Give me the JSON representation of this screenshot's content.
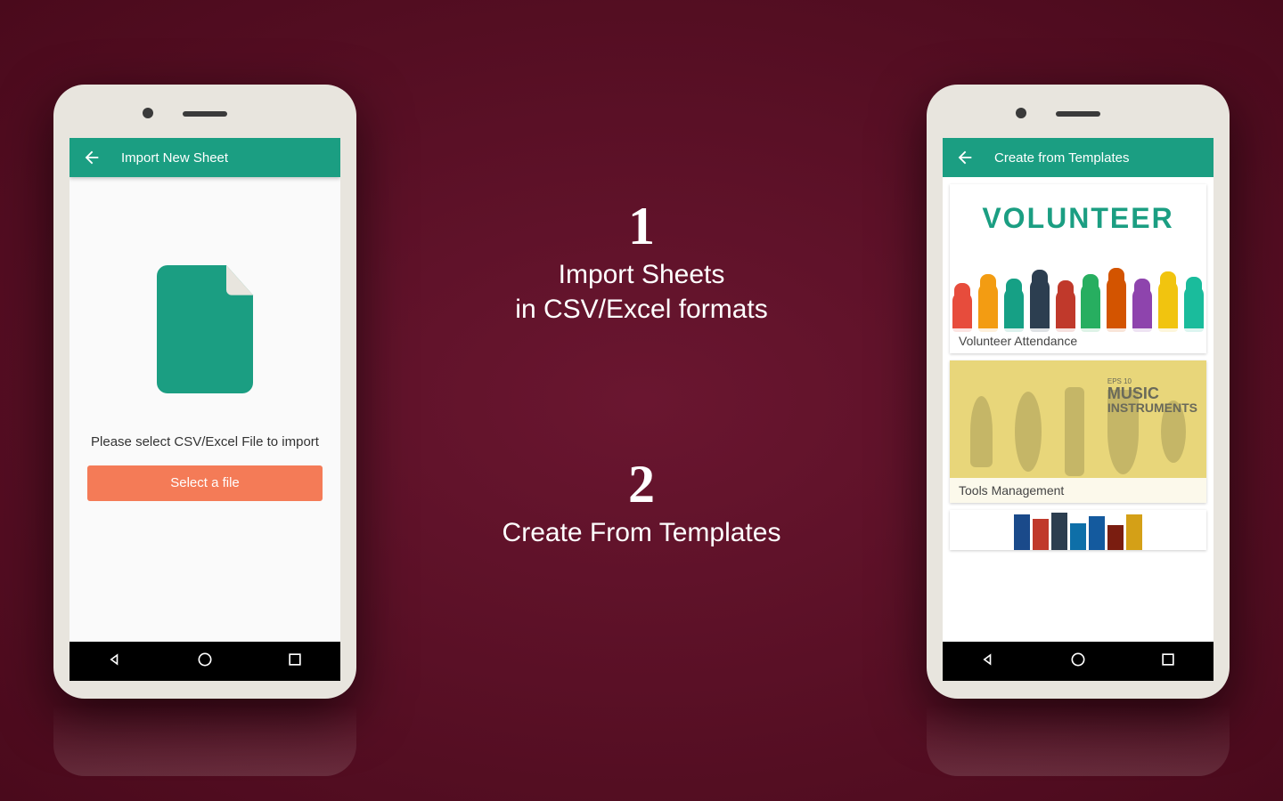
{
  "phone_left": {
    "app_bar_title": "Import New Sheet",
    "instruction": "Please select CSV/Excel File to import",
    "button_label": "Select a file"
  },
  "phone_right": {
    "app_bar_title": "Create from Templates",
    "templates": [
      {
        "label": "Volunteer Attendance",
        "heading": "VOLUNTEER"
      },
      {
        "label": "Tools Management",
        "heading": "MUSIC INSTRUMENTS",
        "subheading": "EPS 10"
      }
    ]
  },
  "center": {
    "step1_num": "1",
    "step1_caption_line1": "Import Sheets",
    "step1_caption_line2": "in CSV/Excel formats",
    "step2_num": "2",
    "step2_caption": "Create From Templates"
  },
  "colors": {
    "accent": "#1b9e82",
    "button": "#f47b57",
    "bg": "#5c0e24"
  }
}
